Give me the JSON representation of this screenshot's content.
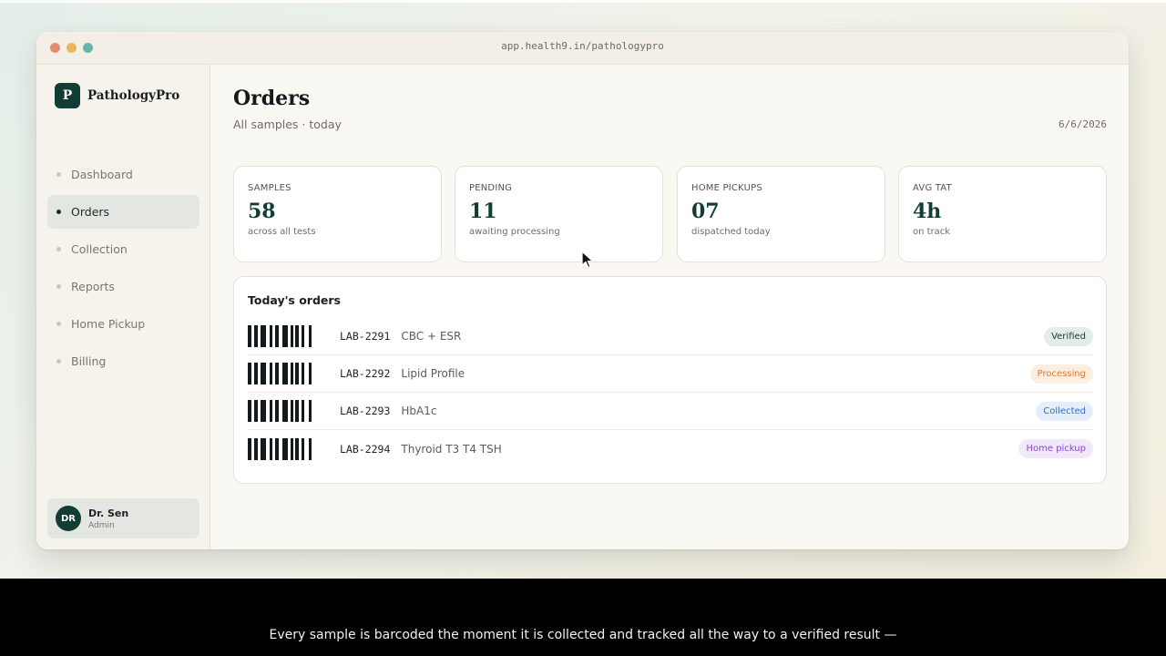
{
  "browser": {
    "url": "app.health9.in/pathologypro"
  },
  "sidebar": {
    "brand_letter": "P",
    "brand_name": "PathologyPro",
    "items": [
      {
        "label": "Dashboard",
        "active": false
      },
      {
        "label": "Orders",
        "active": true
      },
      {
        "label": "Collection",
        "active": false
      },
      {
        "label": "Reports",
        "active": false
      },
      {
        "label": "Home Pickup",
        "active": false
      },
      {
        "label": "Billing",
        "active": false
      }
    ],
    "user": {
      "initials": "DR",
      "name": "Dr. Sen",
      "role": "Admin"
    }
  },
  "header": {
    "title": "Orders",
    "subtitle": "All samples · today",
    "date": "6/6/2026"
  },
  "stats": [
    {
      "label": "SAMPLES",
      "value": "58",
      "caption": "across all tests"
    },
    {
      "label": "PENDING",
      "value": "11",
      "caption": "awaiting processing"
    },
    {
      "label": "HOME PICKUPS",
      "value": "07",
      "caption": "dispatched today"
    },
    {
      "label": "AVG TAT",
      "value": "4h",
      "caption": "on track"
    }
  ],
  "orders": {
    "title": "Today's orders",
    "rows": [
      {
        "id": "LAB-2291",
        "test": "CBC + ESR",
        "status": "Verified"
      },
      {
        "id": "LAB-2292",
        "test": "Lipid Profile",
        "status": "Processing"
      },
      {
        "id": "LAB-2293",
        "test": "HbA1c",
        "status": "Collected"
      },
      {
        "id": "LAB-2294",
        "test": "Thyroid T3 T4 TSH",
        "status": "Home pickup"
      }
    ]
  },
  "status_colors": {
    "Verified": {
      "bg": "#e4ece8",
      "fg": "#1f3a33"
    },
    "Processing": {
      "bg": "#fdeee2",
      "fg": "#d9783a"
    },
    "Collected": {
      "bg": "#e6eefb",
      "fg": "#2f6bd0"
    },
    "Home pickup": {
      "bg": "#f2e8fb",
      "fg": "#8a45c4"
    }
  },
  "colors": {
    "accent": "#123d35",
    "window_bg": "#faf8f3"
  },
  "caption": {
    "text": "Every sample is barcoded the moment it is collected and tracked all the way to a verified result —"
  }
}
